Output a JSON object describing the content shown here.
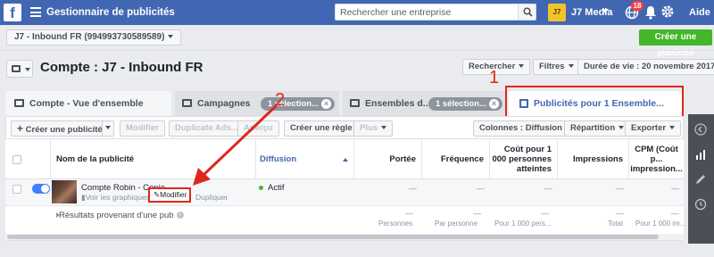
{
  "topbar": {
    "logo": "f",
    "app_title": "Gestionnaire de publicités",
    "search_placeholder": "Rechercher une entreprise",
    "account_avatar": "J7",
    "account_name": "J7 Media",
    "notifications": "18",
    "help": "Aide",
    "icons": [
      "facebook-logo",
      "menu-icon",
      "search-icon",
      "globe-icon",
      "bell-icon",
      "gear-icon"
    ],
    "color": "#4267b2"
  },
  "account_bar": {
    "account_select": "J7 - Inbound FR (994993730589589)",
    "create_ad": "Créer une publicité"
  },
  "header": {
    "title": "Compte : J7 - Inbound FR",
    "search": "Rechercher",
    "filters": "Filtres",
    "date_range": "Durée de vie : 20 novembre 2017"
  },
  "tabs": [
    {
      "label": "Compte - Vue d'ensemble"
    },
    {
      "label": "Campagnes",
      "pill": "1 sélection..."
    },
    {
      "label": "Ensembles d...",
      "pill": "1 sélection..."
    },
    {
      "label": "Publicités pour 1 Ensemble..."
    }
  ],
  "toolbar": {
    "create_ad": "Créer une publicité",
    "edit": "Modifier",
    "duplicate": "Duplicate Ads...",
    "preview": "Aperçu",
    "create_rule": "Créer une règle",
    "more": "Plus",
    "columns": "Colonnes : Diffusion",
    "breakdown": "Répartition",
    "export": "Exporter"
  },
  "table": {
    "columns": [
      "Nom de la publicité",
      "Diffusion",
      "Portée",
      "Fréquence",
      "Coût pour 1 000 personnes atteintes",
      "Impressions",
      "CPM (Coût p... impression..."
    ],
    "rows": [
      {
        "name": "Compte Robin - Copie",
        "actions": [
          "Voir les graphiques",
          "Modifier",
          "Dupliquer"
        ],
        "status": "Actif",
        "cells": [
          "—",
          "—",
          "—",
          "—",
          "—"
        ]
      }
    ],
    "summary": {
      "label": "Résultats provenant d'une pub",
      "cells": [
        "—",
        "—",
        "—",
        "—",
        "—"
      ],
      "units": [
        "Personnes",
        "Par personne",
        "Pour 1 000 pers...",
        "Total",
        "Pour 1 000 im..."
      ]
    }
  },
  "annotations": {
    "step1": "1",
    "step2": "2",
    "color": "#e0271b"
  }
}
